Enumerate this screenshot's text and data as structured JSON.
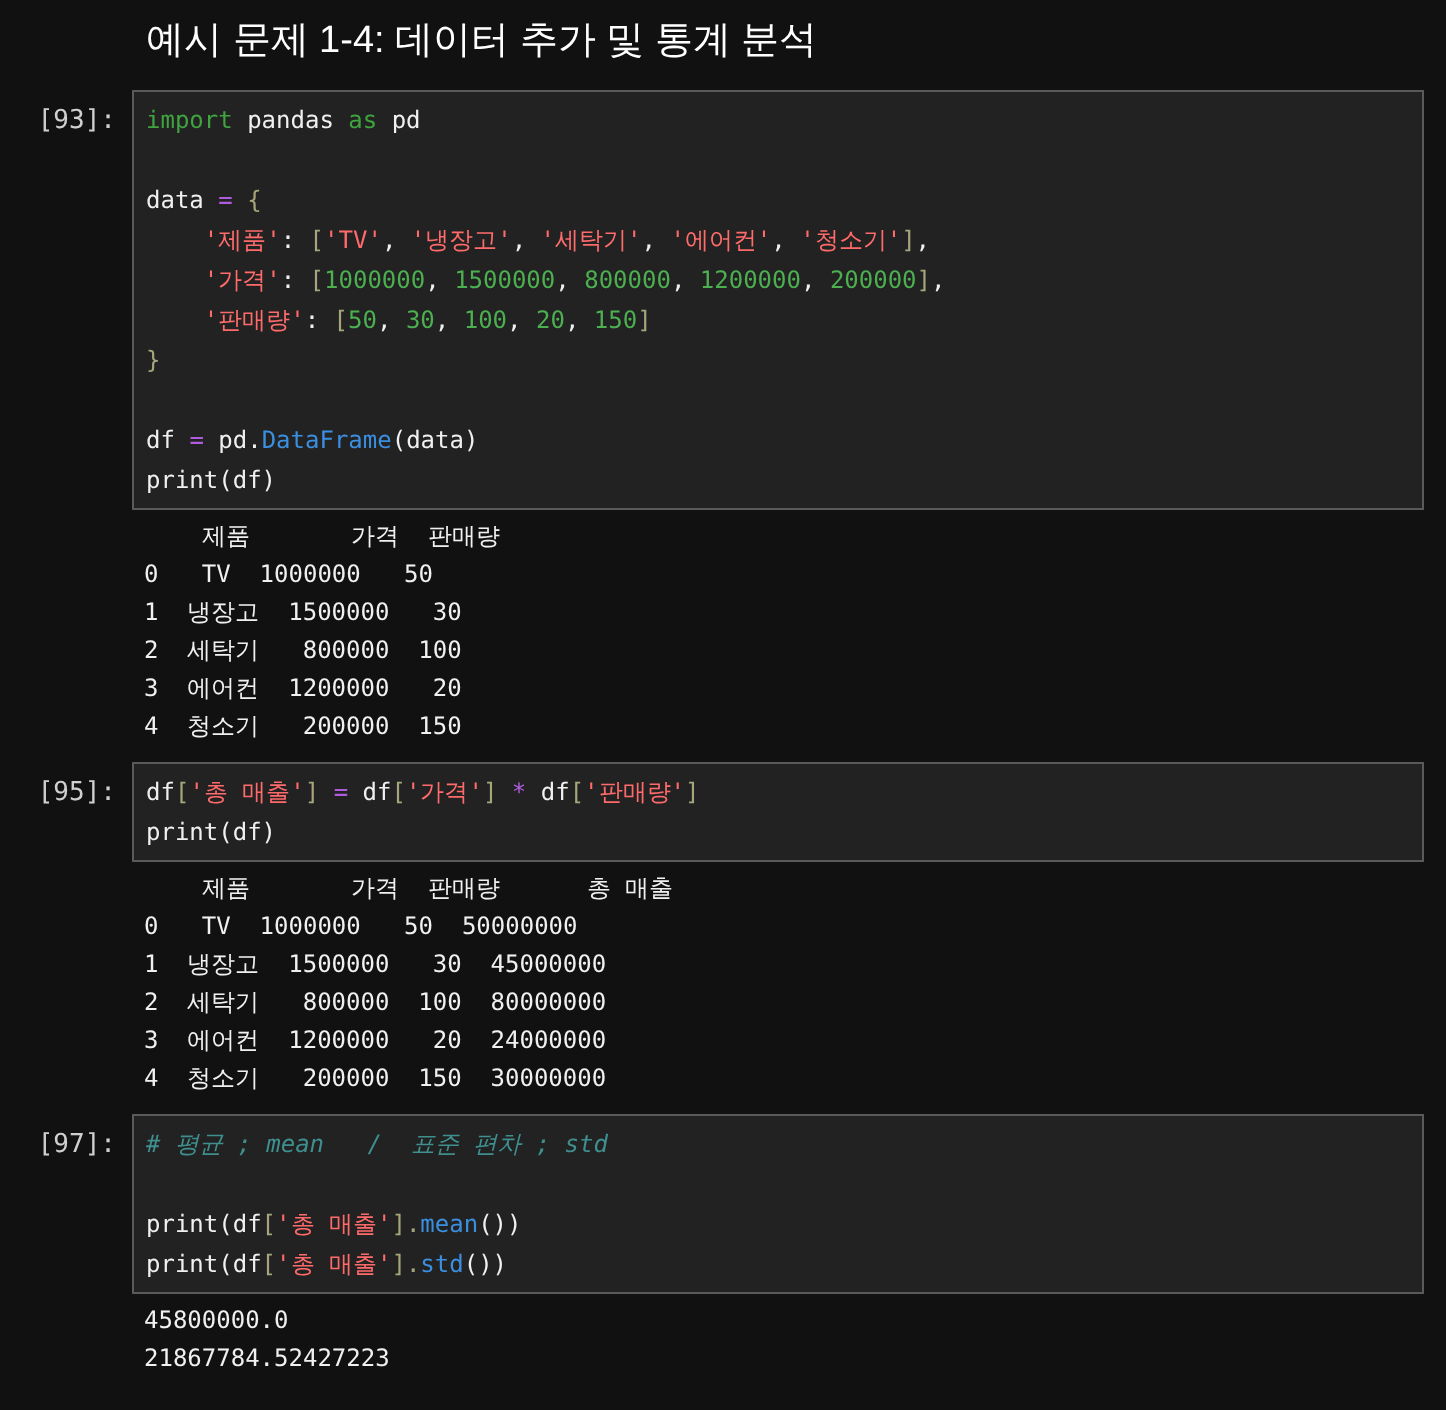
{
  "heading": "예시 문제 1-4: 데이터 추가 및 통계 분석",
  "cells": [
    {
      "prompt": "[93]:",
      "lines": [
        {
          "kind": "code",
          "tokens": [
            {
              "kind": "kw",
              "text": "import"
            },
            {
              "kind": "name",
              "text": " pandas "
            },
            {
              "kind": "kw",
              "text": "as"
            },
            {
              "kind": "name",
              "text": " pd"
            }
          ]
        },
        {
          "kind": "blank"
        },
        {
          "kind": "code",
          "tokens": [
            {
              "kind": "name",
              "text": "data"
            },
            {
              "kind": "op",
              "text": " = "
            },
            {
              "kind": "punct",
              "text": "{"
            }
          ]
        },
        {
          "kind": "code",
          "indented": true,
          "tokens": [
            {
              "kind": "str",
              "text": "'제품'"
            },
            {
              "kind": "name",
              "text": ": "
            },
            {
              "kind": "punct",
              "text": "["
            },
            {
              "kind": "str",
              "text": "'TV'"
            },
            {
              "kind": "name",
              "text": ", "
            },
            {
              "kind": "str",
              "text": "'냉장고'"
            },
            {
              "kind": "name",
              "text": ", "
            },
            {
              "kind": "str",
              "text": "'세탁기'"
            },
            {
              "kind": "name",
              "text": ", "
            },
            {
              "kind": "str",
              "text": "'에어컨'"
            },
            {
              "kind": "name",
              "text": ", "
            },
            {
              "kind": "str",
              "text": "'청소기'"
            },
            {
              "kind": "punct",
              "text": "]"
            },
            {
              "kind": "name",
              "text": ","
            }
          ]
        },
        {
          "kind": "code",
          "indented": true,
          "tokens": [
            {
              "kind": "str",
              "text": "'가격'"
            },
            {
              "kind": "name",
              "text": ": "
            },
            {
              "kind": "punct",
              "text": "["
            },
            {
              "kind": "num",
              "text": "1000000"
            },
            {
              "kind": "name",
              "text": ", "
            },
            {
              "kind": "num",
              "text": "1500000"
            },
            {
              "kind": "name",
              "text": ", "
            },
            {
              "kind": "num",
              "text": "800000"
            },
            {
              "kind": "name",
              "text": ", "
            },
            {
              "kind": "num",
              "text": "1200000"
            },
            {
              "kind": "name",
              "text": ", "
            },
            {
              "kind": "num",
              "text": "200000"
            },
            {
              "kind": "punct",
              "text": "]"
            },
            {
              "kind": "name",
              "text": ","
            }
          ]
        },
        {
          "kind": "code",
          "indented": true,
          "tokens": [
            {
              "kind": "str",
              "text": "'판매량'"
            },
            {
              "kind": "name",
              "text": ": "
            },
            {
              "kind": "punct",
              "text": "["
            },
            {
              "kind": "num",
              "text": "50"
            },
            {
              "kind": "name",
              "text": ", "
            },
            {
              "kind": "num",
              "text": "30"
            },
            {
              "kind": "name",
              "text": ", "
            },
            {
              "kind": "num",
              "text": "100"
            },
            {
              "kind": "name",
              "text": ", "
            },
            {
              "kind": "num",
              "text": "20"
            },
            {
              "kind": "name",
              "text": ", "
            },
            {
              "kind": "num",
              "text": "150"
            },
            {
              "kind": "punct",
              "text": "]"
            }
          ]
        },
        {
          "kind": "code",
          "tokens": [
            {
              "kind": "punct",
              "text": "}"
            }
          ]
        },
        {
          "kind": "blank"
        },
        {
          "kind": "code",
          "tokens": [
            {
              "kind": "name",
              "text": "df "
            },
            {
              "kind": "op",
              "text": "="
            },
            {
              "kind": "name",
              "text": " pd."
            },
            {
              "kind": "func",
              "text": "DataFrame"
            },
            {
              "kind": "name",
              "text": "(data)"
            }
          ]
        },
        {
          "kind": "code",
          "tokens": [
            {
              "kind": "name",
              "text": "print(df)"
            }
          ]
        }
      ],
      "output": [
        "    제품       가격  판매량",
        "0   TV  1000000   50",
        "1  냉장고  1500000   30",
        "2  세탁기   800000  100",
        "3  에어컨  1200000   20",
        "4  청소기   200000  150"
      ]
    },
    {
      "prompt": "[95]:",
      "lines": [
        {
          "kind": "code",
          "tokens": [
            {
              "kind": "name",
              "text": "df"
            },
            {
              "kind": "punct",
              "text": "["
            },
            {
              "kind": "str",
              "text": "'총 매출'"
            },
            {
              "kind": "punct",
              "text": "]"
            },
            {
              "kind": "op",
              "text": " = "
            },
            {
              "kind": "name",
              "text": "df"
            },
            {
              "kind": "punct",
              "text": "["
            },
            {
              "kind": "str",
              "text": "'가격'"
            },
            {
              "kind": "punct",
              "text": "]"
            },
            {
              "kind": "op",
              "text": " * "
            },
            {
              "kind": "name",
              "text": "df"
            },
            {
              "kind": "punct",
              "text": "["
            },
            {
              "kind": "str",
              "text": "'판매량'"
            },
            {
              "kind": "punct",
              "text": "]"
            }
          ]
        },
        {
          "kind": "code",
          "tokens": [
            {
              "kind": "name",
              "text": "print(df)"
            }
          ]
        }
      ],
      "output": [
        "    제품       가격  판매량      총 매출",
        "0   TV  1000000   50  50000000",
        "1  냉장고  1500000   30  45000000",
        "2  세탁기   800000  100  80000000",
        "3  에어컨  1200000   20  24000000",
        "4  청소기   200000  150  30000000"
      ]
    },
    {
      "prompt": "[97]:",
      "lines": [
        {
          "kind": "code",
          "tokens": [
            {
              "kind": "comment",
              "text": "# 평균 ; mean   /  표준 편차 ; std"
            }
          ]
        },
        {
          "kind": "blank"
        },
        {
          "kind": "code",
          "tokens": [
            {
              "kind": "name",
              "text": "print(df"
            },
            {
              "kind": "punct",
              "text": "["
            },
            {
              "kind": "str",
              "text": "'총 매출'"
            },
            {
              "kind": "punct",
              "text": "]."
            },
            {
              "kind": "func",
              "text": "mean"
            },
            {
              "kind": "name",
              "text": "())"
            }
          ]
        },
        {
          "kind": "code",
          "tokens": [
            {
              "kind": "name",
              "text": "print(df"
            },
            {
              "kind": "punct",
              "text": "["
            },
            {
              "kind": "str",
              "text": "'총 매출'"
            },
            {
              "kind": "punct",
              "text": "]."
            },
            {
              "kind": "func",
              "text": "std"
            },
            {
              "kind": "name",
              "text": "())"
            }
          ]
        }
      ],
      "output": [
        "45800000.0",
        "21867784.52427223"
      ]
    }
  ]
}
